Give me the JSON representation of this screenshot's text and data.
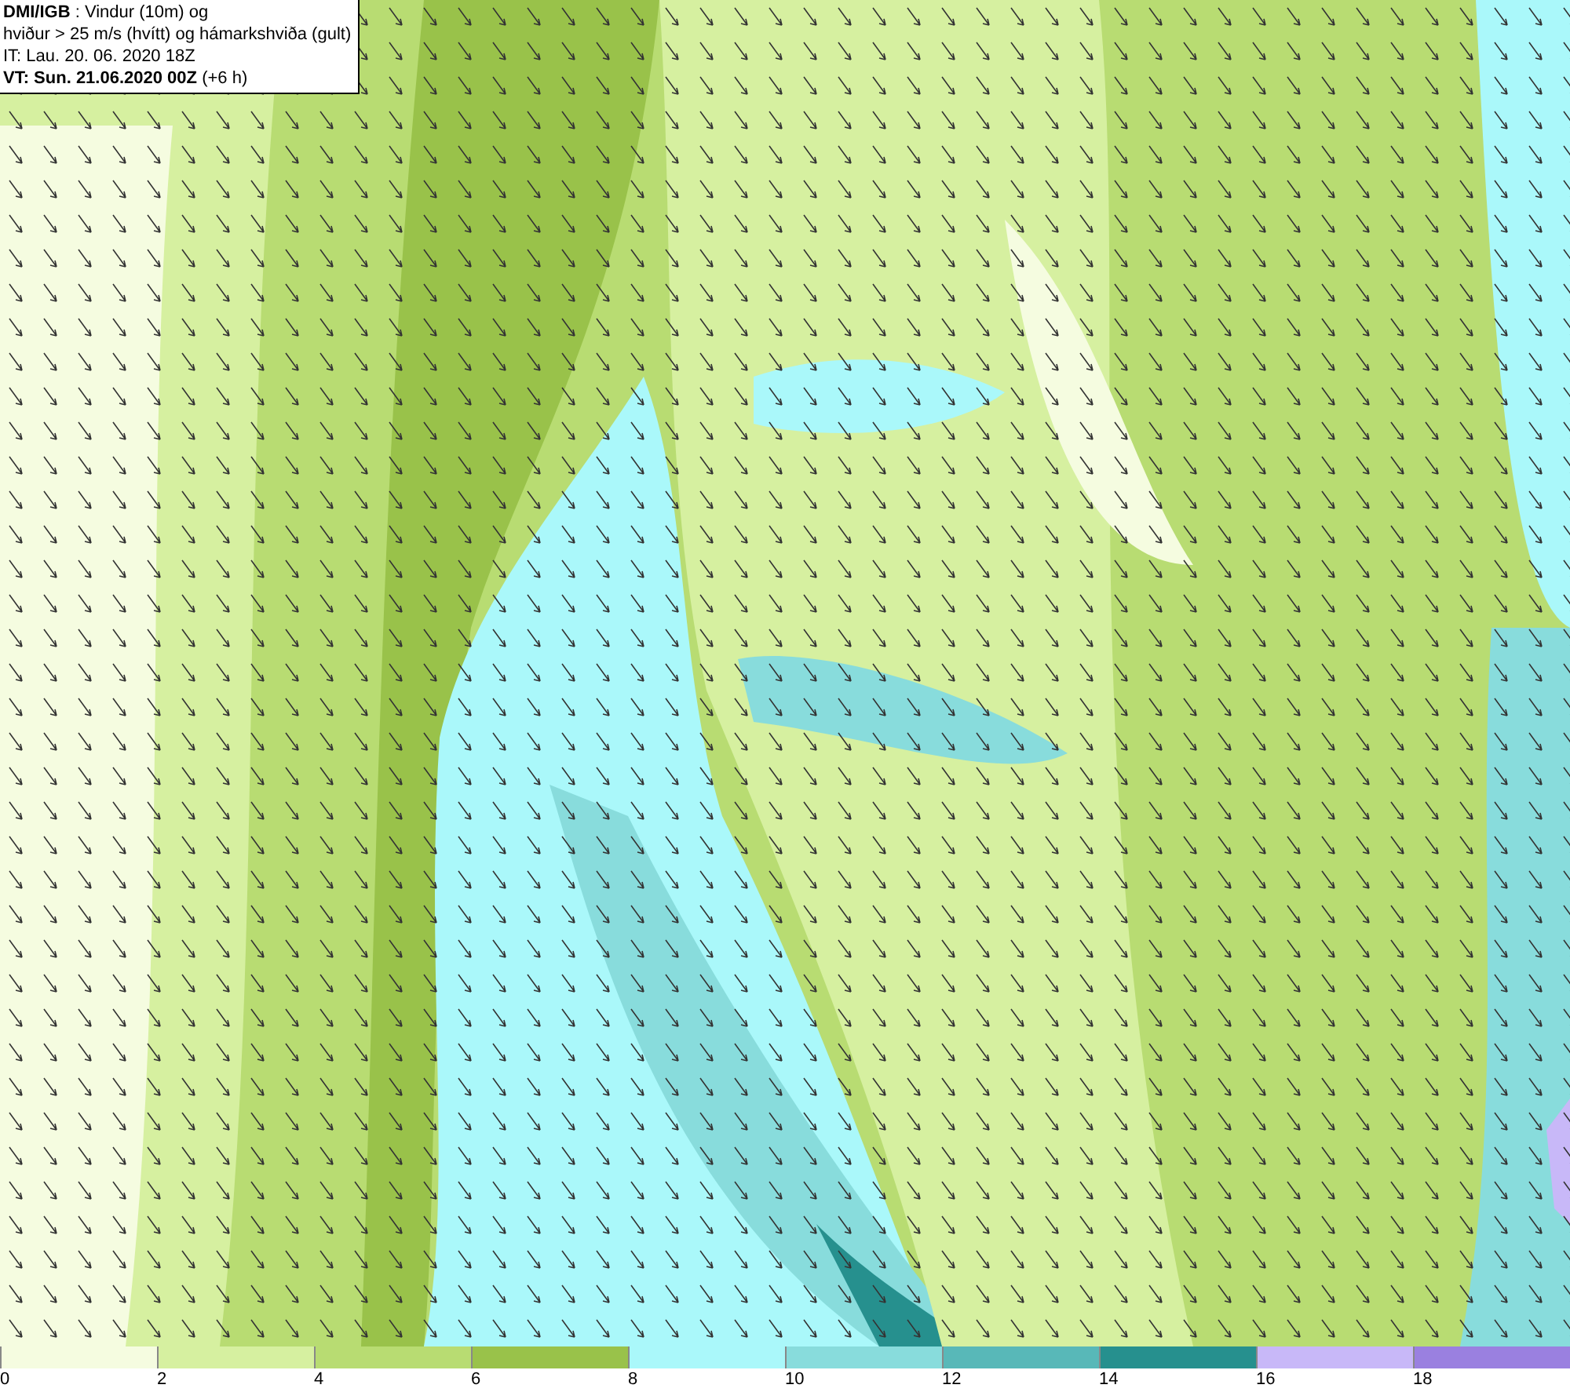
{
  "title_box": {
    "lines": [
      "**DMI/IGB** : Vindur (10m) og",
      "hviður > 25 m/s (hvítt) og hámarkshviða (gult)",
      "IT: Lau. 20. 06. 2020 18Z",
      "**VT: Sun. 21.06.2020 00Z** (+6 h)"
    ]
  },
  "legend": [
    {
      "label": "0",
      "color": "#f5fce0"
    },
    {
      "label": "2",
      "color": "#d6f0a0"
    },
    {
      "label": "4",
      "color": "#b8dc72"
    },
    {
      "label": "6",
      "color": "#99c24a"
    },
    {
      "label": "8",
      "color": "#aaf8fa"
    },
    {
      "label": "10",
      "color": "#88dcdc"
    },
    {
      "label": "12",
      "color": "#58b8b8"
    },
    {
      "label": "14",
      "color": "#26908e"
    },
    {
      "label": "16",
      "color": "#c8b8f8"
    },
    {
      "label": "18",
      "color": "#9a80e0"
    }
  ]
}
